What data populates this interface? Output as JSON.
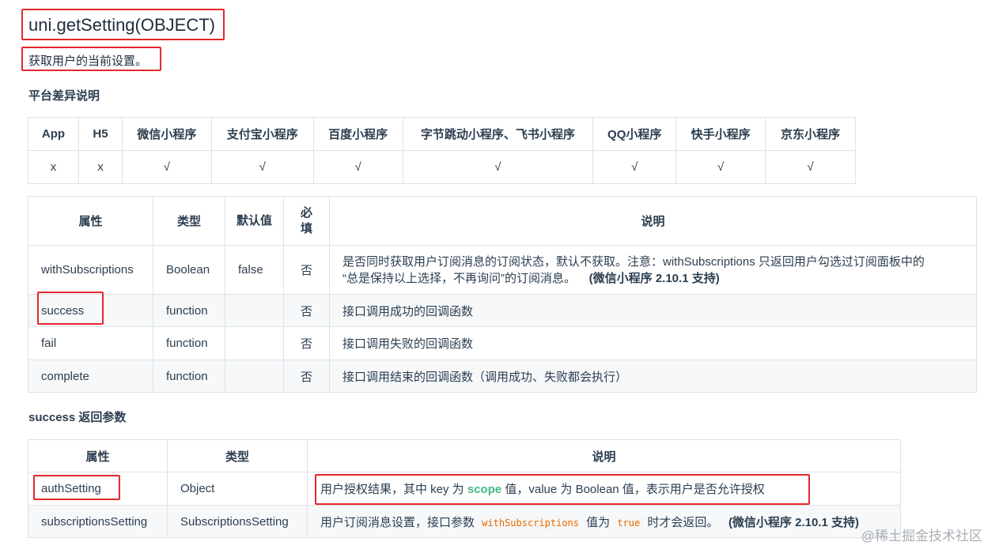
{
  "page": {
    "title": "uni.getSetting(OBJECT)",
    "description": "获取用户的当前设置。"
  },
  "platform": {
    "heading": "平台差异说明",
    "headers": [
      "App",
      "H5",
      "微信小程序",
      "支付宝小程序",
      "百度小程序",
      "字节跳动小程序、飞书小程序",
      "QQ小程序",
      "快手小程序",
      "京东小程序"
    ],
    "values": [
      "x",
      "x",
      "√",
      "√",
      "√",
      "√",
      "√",
      "√",
      "√"
    ]
  },
  "params": {
    "headers": [
      "属性",
      "类型",
      "默认值",
      "必填",
      "说明"
    ],
    "rows": [
      {
        "name": "withSubscriptions",
        "type": "Boolean",
        "default": "false",
        "required": "否",
        "desc_line1": "是否同时获取用户订阅消息的订阅状态，默认不获取。注意：withSubscriptions 只返回用户勾选过订阅面板中的",
        "desc_line2": "“总是保持以上选择，不再询问”的订阅消息。",
        "desc_note": "(微信小程序 2.10.1 支持)"
      },
      {
        "name": "success",
        "type": "function",
        "default": "",
        "required": "否",
        "desc": "接口调用成功的回调函数"
      },
      {
        "name": "fail",
        "type": "function",
        "default": "",
        "required": "否",
        "desc": "接口调用失败的回调函数"
      },
      {
        "name": "complete",
        "type": "function",
        "default": "",
        "required": "否",
        "desc": "接口调用结束的回调函数（调用成功、失败都会执行）"
      }
    ]
  },
  "success_return": {
    "heading": "success 返回参数",
    "headers": [
      "属性",
      "类型",
      "说明"
    ],
    "rows": [
      {
        "name": "authSetting",
        "type": "Object",
        "desc_a": "用户授权结果，其中 key 为 ",
        "desc_scope": "scope",
        "desc_b": " 值，value 为 Boolean 值，表示用户是否允许授权"
      },
      {
        "name": "subscriptionsSetting",
        "type": "SubscriptionsSetting",
        "desc_a": "用户订阅消息设置，接口参数 ",
        "code1": "withSubscriptions",
        "desc_b": " 值为 ",
        "code2": "true",
        "desc_c": " 时才会返回。",
        "desc_note": "(微信小程序 2.10.1 支持)"
      }
    ]
  },
  "watermark": "@稀土掘金技术社区",
  "colors": {
    "highlight_box": "#e5282c",
    "scope_green": "#42b983",
    "code_orange": "#e96900"
  }
}
